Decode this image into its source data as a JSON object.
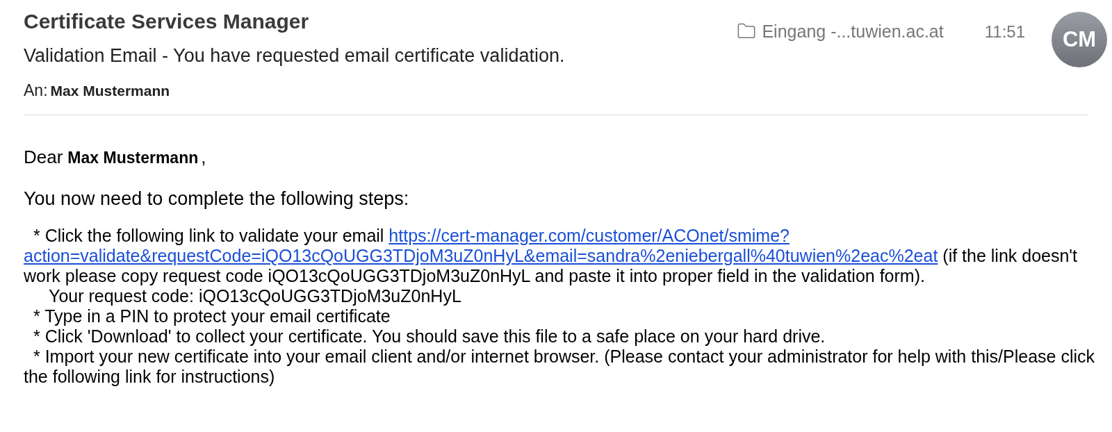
{
  "message": {
    "sender": "Certificate Services Manager",
    "mailbox": "Eingang -...tuwien.ac.at",
    "time": "11:51",
    "avatar": "CM",
    "subject": "Validation Email - You have requested email certificate validation.",
    "to_label": "An:",
    "to": "Max Mustermann"
  },
  "body": {
    "greeting": "Dear",
    "greeting_name": "Max Mustermann",
    "greeting_end": ",",
    "intro": "You now need to complete the following steps:",
    "steps": [
      {
        "kind": "bullet",
        "text": "* Click the following link to validate your email",
        "link_lines": [
          "https://cert-manager.com/customer/ACOnet/smime?",
          "action=validate&requestCode=iQO13cQoUGG3TDjoM3uZ0nHyL&email=sandra%2eniebergall%40tuwien%2eac%2eat"
        ],
        "after": "(if the link doesn't work please copy request code iQO13cQoUGG3TDjoM3uZ0nHyL and paste it into proper field in the validation form)."
      },
      {
        "kind": "note",
        "text": "Your request code: iQO13cQoUGG3TDjoM3uZ0nHyL"
      },
      {
        "kind": "bullet",
        "text": "* Type in a PIN to protect your email certificate"
      },
      {
        "kind": "bullet",
        "text": "* Click 'Download' to collect your certificate. You should save this file to a safe place on your hard drive."
      },
      {
        "kind": "bullet",
        "text": "* Import your new certificate into your email client and/or internet browser. (Please contact your administrator for help with this/Please click the following link for instructions)"
      }
    ]
  }
}
